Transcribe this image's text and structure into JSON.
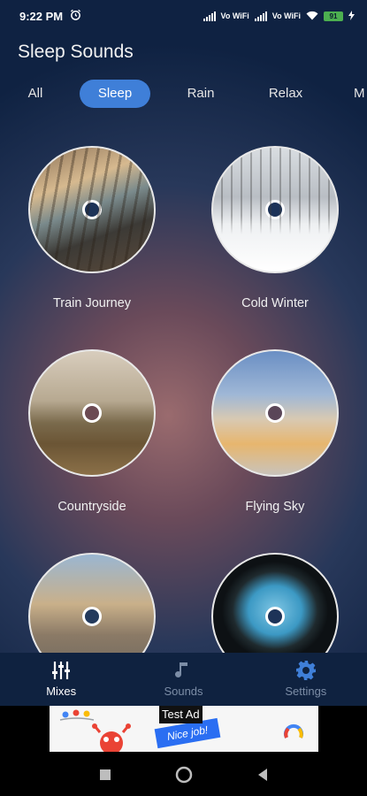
{
  "status_bar": {
    "time": "9:22 PM",
    "network_labels": [
      "Vo WiFi",
      "Vo WiFi"
    ],
    "battery": "91"
  },
  "app": {
    "title": "Sleep Sounds"
  },
  "tabs": [
    {
      "label": "All",
      "active": false
    },
    {
      "label": "Sleep",
      "active": true
    },
    {
      "label": "Rain",
      "active": false
    },
    {
      "label": "Relax",
      "active": false
    },
    {
      "label": "M",
      "active": false
    }
  ],
  "sounds": [
    {
      "title": "Train Journey",
      "image": "train-station-photo"
    },
    {
      "title": "Cold Winter",
      "image": "snowy-forest-photo"
    },
    {
      "title": "Countryside",
      "image": "countryside-hut-photo"
    },
    {
      "title": "Flying Sky",
      "image": "airplane-wing-photo"
    },
    {
      "title": "",
      "image": "city-skyline-photo"
    },
    {
      "title": "",
      "image": "sea-cave-photo"
    }
  ],
  "bottom_nav": [
    {
      "label": "Mixes",
      "icon": "sliders-icon",
      "active": true
    },
    {
      "label": "Sounds",
      "icon": "music-note-icon",
      "active": false
    },
    {
      "label": "Settings",
      "icon": "gear-icon",
      "active": false
    }
  ],
  "ad": {
    "label": "Test Ad",
    "slogan": "Nice job!"
  },
  "colors": {
    "accent": "#3f7fd8",
    "nav_bg": "#0f2240",
    "inactive": "#7c8da6"
  }
}
